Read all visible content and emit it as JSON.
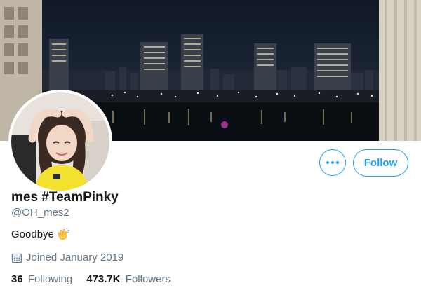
{
  "profile": {
    "display_name": "mes #TeamPinky",
    "handle": "@OH_mes2",
    "bio": "Goodbye",
    "bio_emoji": "clapping-hands-icon",
    "joined": "Joined January 2019",
    "following_count": "36",
    "following_label": "Following",
    "followers_count": "473.7K",
    "followers_label": "Followers"
  },
  "actions": {
    "follow_label": "Follow",
    "more_icon": "more-horizontal-icon"
  },
  "colors": {
    "accent": "#1da1f2",
    "text_primary": "#14171a",
    "text_secondary": "#657786"
  }
}
